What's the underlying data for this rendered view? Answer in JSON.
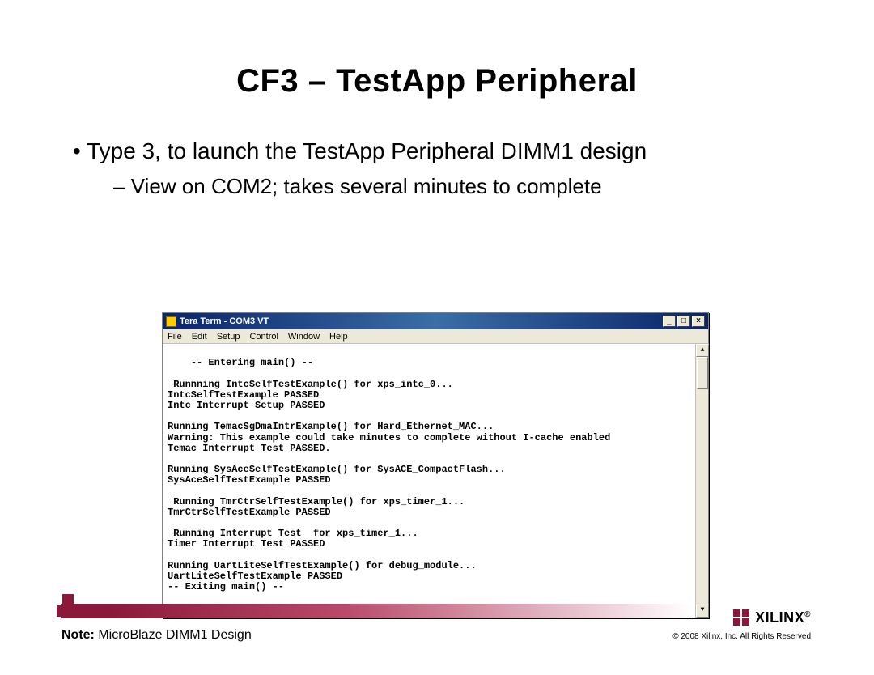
{
  "slide": {
    "title": "CF3 – TestApp Peripheral",
    "bullet1": "Type 3, to launch the TestApp Peripheral DIMM1 design",
    "bullet2": "View on COM2; takes several minutes to complete"
  },
  "terminal": {
    "title": "Tera Term - COM3 VT",
    "menu": {
      "file": "File",
      "edit": "Edit",
      "setup": "Setup",
      "control": "Control",
      "window": "Window",
      "help": "Help"
    },
    "output": "-- Entering main() --\n\n Runnning IntcSelfTestExample() for xps_intc_0...\nIntcSelfTestExample PASSED\nIntc Interrupt Setup PASSED\n\nRunning TemacSgDmaIntrExample() for Hard_Ethernet_MAC...\nWarning: This example could take minutes to complete without I-cache enabled\nTemac Interrupt Test PASSED.\n\nRunning SysAceSelfTestExample() for SysACE_CompactFlash...\nSysAceSelfTestExample PASSED\n\n Running TmrCtrSelfTestExample() for xps_timer_1...\nTmrCtrSelfTestExample PASSED\n\n Running Interrupt Test  for xps_timer_1...\nTimer Interrupt Test PASSED\n\nRunning UartLiteSelfTestExample() for debug_module...\nUartLiteSelfTestExample PASSED\n-- Exiting main() --"
  },
  "footer": {
    "note_label": "Note:",
    "note_text": " MicroBlaze DIMM1 Design",
    "logo_text": "XILINX",
    "copyright": "© 2008 Xilinx, Inc. All Rights Reserved"
  },
  "winbtns": {
    "min": "_",
    "max": "□",
    "close": "×"
  }
}
